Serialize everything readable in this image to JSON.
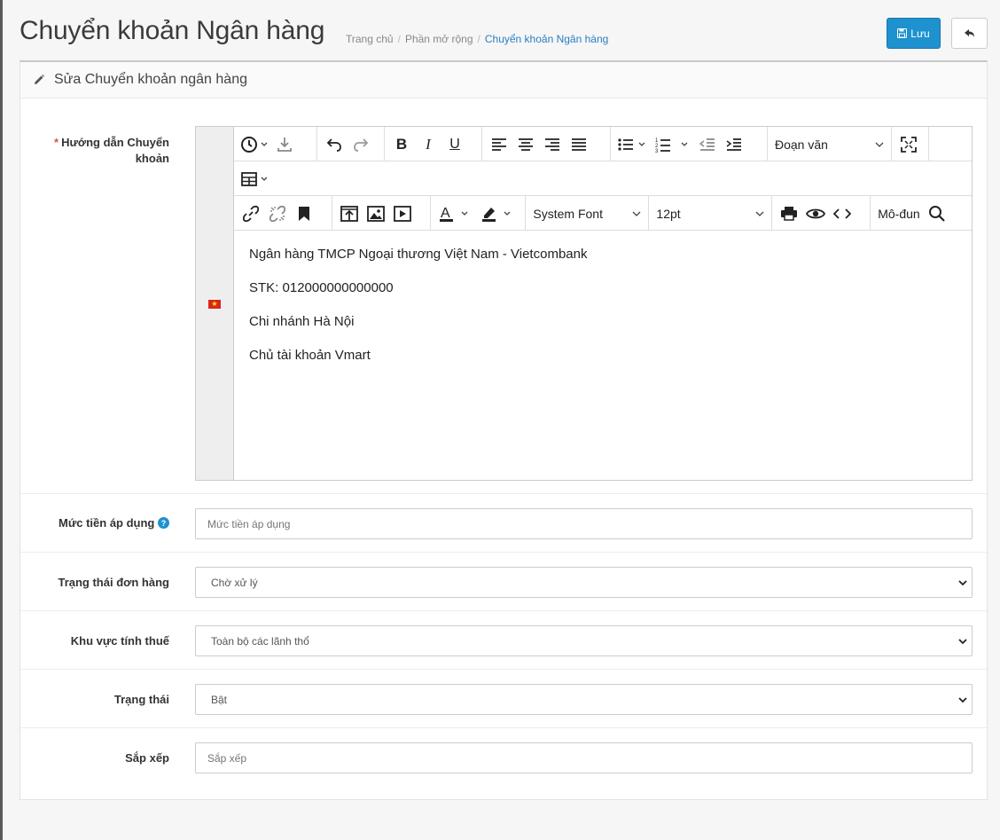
{
  "header": {
    "title": "Chuyển khoản Ngân hàng",
    "breadcrumb": [
      "Trang chủ",
      "Phần mở rộng",
      "Chuyển khoản Ngân hàng"
    ],
    "save_label": "Lưu"
  },
  "panel": {
    "heading": "Sửa Chuyển khoản ngân hàng"
  },
  "form": {
    "instructions": {
      "label": "Hướng dẫn Chuyển khoản",
      "required": "*",
      "toolbar": {
        "block_format": "Đoạn văn",
        "font_family": "System Font",
        "font_size": "12pt",
        "module": "Mô-đun"
      },
      "lines": [
        "Ngân hàng TMCP Ngoại thương Việt Nam - Vietcombank",
        "STK: 012000000000000",
        "Chi nhánh Hà Nội",
        "Chủ tài khoản Vmart"
      ]
    },
    "total": {
      "label": "Mức tiền áp dụng",
      "placeholder": "Mức tiền áp dụng"
    },
    "order_status": {
      "label": "Trạng thái đơn hàng",
      "value": "Chờ xử lý"
    },
    "geo_zone": {
      "label": "Khu vực tính thuế",
      "value": "Toàn bộ các lãnh thổ"
    },
    "status": {
      "label": "Trạng thái",
      "value": "Bật"
    },
    "sort_order": {
      "label": "Sắp xếp",
      "placeholder": "Sắp xếp"
    }
  },
  "colors": {
    "primary": "#1e91cf",
    "required": "#d9534f",
    "link": "#2a7fc1"
  }
}
